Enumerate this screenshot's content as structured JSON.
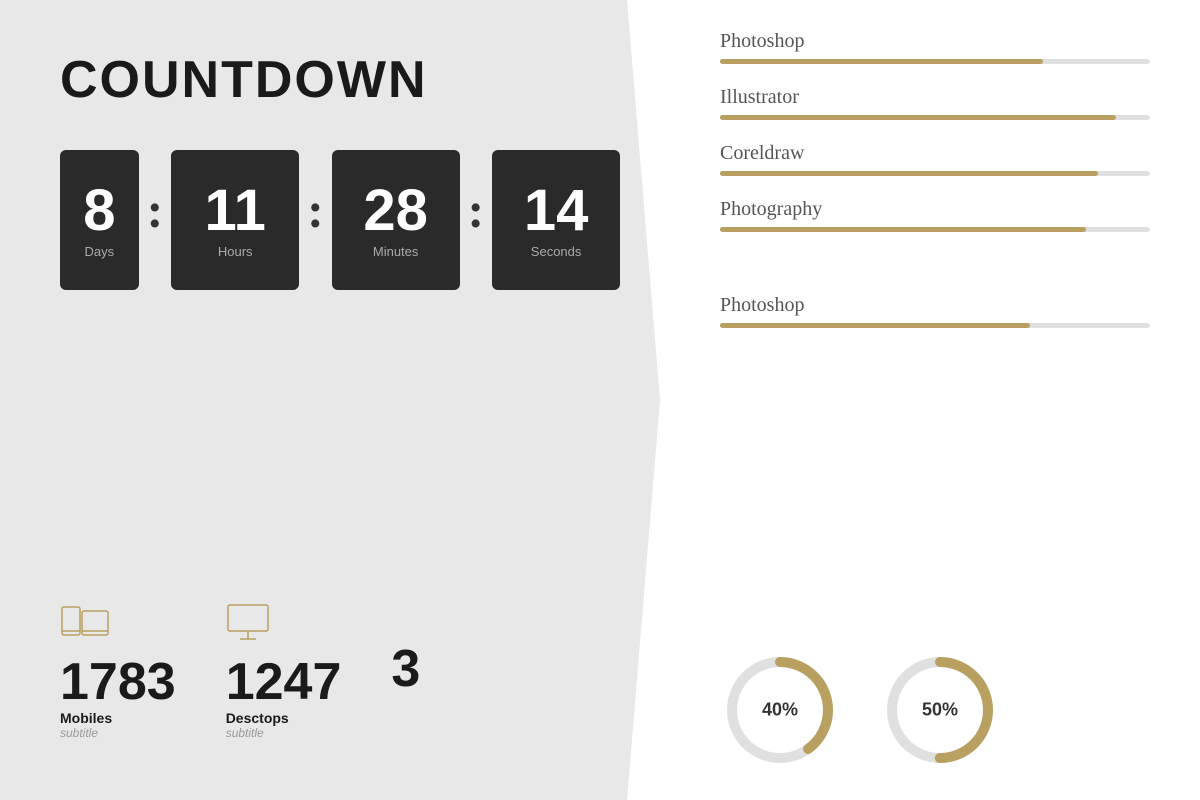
{
  "left": {
    "title": "COUNTDOWN",
    "timer": {
      "days": {
        "value": "8",
        "label": "Days",
        "partial": true
      },
      "hours": {
        "value": "11",
        "label": "Hours"
      },
      "minutes": {
        "value": "28",
        "label": "Minutes"
      },
      "seconds": {
        "value": "14",
        "label": "Seconds"
      }
    },
    "stats": [
      {
        "id": "mobiles",
        "number": "1783",
        "title": "Mobiles",
        "subtitle": "subtitle",
        "icon": "mobile"
      },
      {
        "id": "desktops",
        "number": "1247",
        "title": "Desctops",
        "subtitle": "subtitle",
        "icon": "desktop"
      },
      {
        "id": "other",
        "number": "3",
        "title": "",
        "subtitle": "",
        "icon": "",
        "partial": true
      }
    ]
  },
  "right": {
    "skills": [
      {
        "name": "Photoshop",
        "percent": 75
      },
      {
        "name": "Illustrator",
        "percent": 92
      },
      {
        "name": "Coreldraw",
        "percent": 88
      },
      {
        "name": "Photography",
        "percent": 85
      }
    ],
    "skills2": [
      {
        "name": "Photoshop",
        "percent": 72
      }
    ],
    "donuts": [
      {
        "label": "40%",
        "value": 40
      },
      {
        "label": "50%",
        "value": 50
      }
    ]
  },
  "colors": {
    "accent": "#b8a060",
    "dark": "#2a2a2a",
    "light_bg": "#e8e8e8"
  }
}
